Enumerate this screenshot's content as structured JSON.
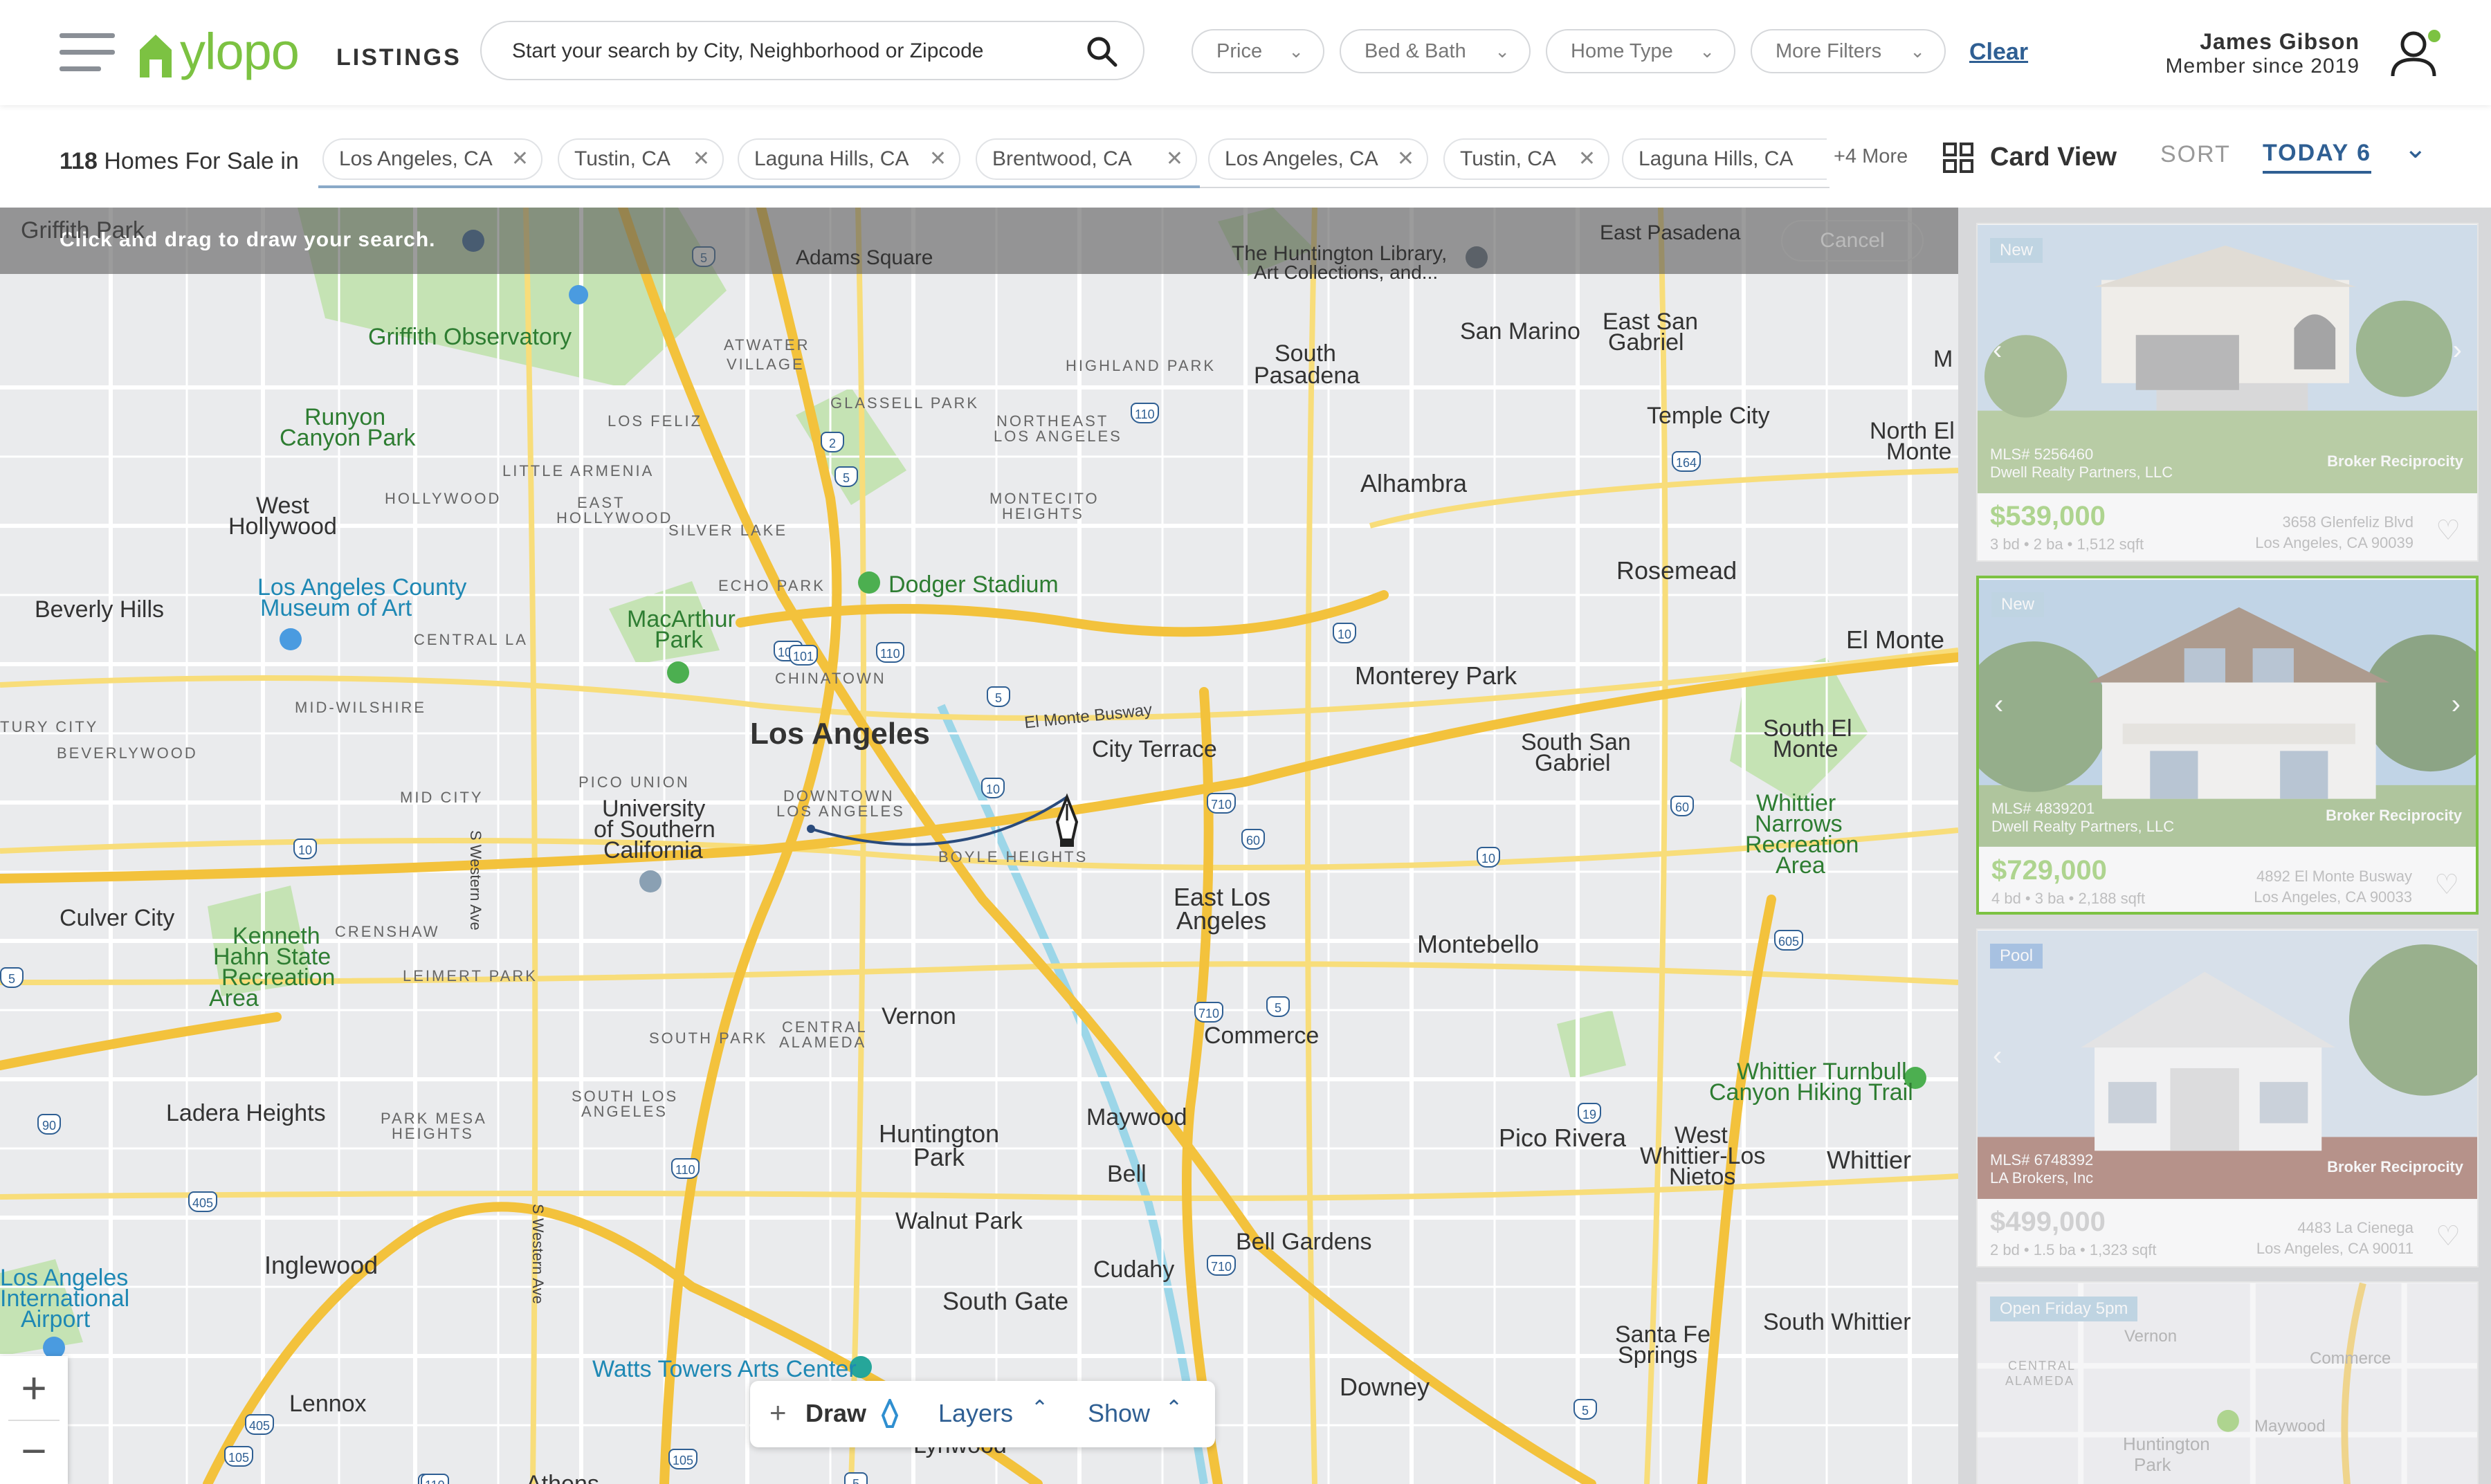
{
  "header": {
    "logo_text": "ylopo",
    "nav_label": "LISTINGS",
    "search": {
      "placeholder": "Start your search by City, Neighborhood or Zipcode"
    },
    "filters": [
      "Price",
      "Bed & Bath",
      "Home Type",
      "More Filters"
    ],
    "clear_label": "Clear",
    "user": {
      "name": "James Gibson",
      "since": "Member since 2019",
      "online_color": "#7cc242"
    }
  },
  "filter_bar": {
    "count": "118",
    "count_suffix": "Homes For Sale in",
    "chips": [
      "Los Angeles, CA",
      "Tustin, CA",
      "Laguna Hills, CA",
      "Brentwood, CA",
      "Los Angeles, CA",
      "Tustin, CA",
      "Laguna Hills, CA"
    ],
    "more_label": "+4 More",
    "view_label": "Card View",
    "sort_label": "SORT",
    "sort_value": "TODAY 6"
  },
  "map": {
    "draw_hint": "Click and drag to draw your search.",
    "cancel_label": "Cancel",
    "labels": {
      "griffith_park": "Griffith Park",
      "adams_square": "Adams Square",
      "huntington_library": "The Huntington Library,",
      "huntington_library2": "Art Collections, and...",
      "east_pasadena": "East Pasadena",
      "griffith_observatory": "Griffith Observatory",
      "atwater": "ATWATER",
      "atwater2": "VILLAGE",
      "highland_park": "HIGHLAND PARK",
      "south_pasadena": "South",
      "south_pasadena2": "Pasadena",
      "san_marino": "San Marino",
      "east_san_gabriel": "East San",
      "east_san_gabriel2": "Gabriel",
      "runyon": "Runyon",
      "runyon2": "Canyon Park",
      "los_feliz": "LOS FELIZ",
      "glassell_park": "GLASSELL PARK",
      "ne_la": "NORTHEAST",
      "ne_la2": "LOS ANGELES",
      "temple_city": "Temple City",
      "north_el_monte": "North El",
      "north_el_monte2": "Monte",
      "little_armenia": "LITTLE ARMENIA",
      "west_hollywood": "West",
      "west_hollywood2": "Hollywood",
      "hollywood": "HOLLYWOOD",
      "east_hollywood": "EAST",
      "east_hollywood2": "HOLLYWOOD",
      "montecito_heights": "MONTECITO",
      "montecito_heights2": "HEIGHTS",
      "alhambra": "Alhambra",
      "silver_lake": "SILVER LAKE",
      "rosemead": "Rosemead",
      "beverly_hills": "Beverly Hills",
      "lacma": "Los Angeles County",
      "lacma2": "Museum of Art",
      "macarthur": "MacArthur",
      "macarthur2": "Park",
      "echo_park": "ECHO PARK",
      "dodger_stadium": "Dodger Stadium",
      "central_la": "CENTRAL LA",
      "el_monte": "El Monte",
      "monterey_park": "Monterey Park",
      "chinatown": "CHINATOWN",
      "mid_wilshire": "MID-WILSHIRE",
      "los_angeles": "Los Angeles",
      "el_monte_busway": "El Monte Busway",
      "city_terrace": "City Terrace",
      "south_san_gabriel": "South San",
      "south_san_gabriel2": "Gabriel",
      "south_el_monte": "South El",
      "south_el_monte2": "Monte",
      "tury_city": "TURY CITY",
      "beverlywood": "BEVERLYWOOD",
      "pico_union": "PICO UNION",
      "downtown": "DOWNTOWN",
      "downtown2": "LOS ANGELES",
      "mid_city": "MID CITY",
      "usc": "University",
      "usc2": "of Southern",
      "usc3": "California",
      "whittier_narrows": "Whittier",
      "whittier_narrows2": "Narrows",
      "whittier_narrows3": "Recreation",
      "whittier_narrows4": "Area",
      "boyle_heights": "BOYLE HEIGHTS",
      "culver_city": "Culver City",
      "crenshaw": "CRENSHAW",
      "east_la": "East Los",
      "east_la2": "Angeles",
      "kenneth_hahn": "Kenneth",
      "kenneth_hahn2": "Hahn State",
      "kenneth_hahn3": "Recreation",
      "kenneth_hahn4": "Area",
      "leimert_park": "LEIMERT PARK",
      "montebello": "Montebello",
      "vernon": "Vernon",
      "commerce": "Commerce",
      "south_park": "SOUTH PARK",
      "central_alameda": "CENTRAL",
      "central_alameda2": "ALAMEDA",
      "whittier_turnbull": "Whittier Turnbull",
      "whittier_turnbull2": "Canyon Hiking Trail",
      "south_la": "SOUTH LOS",
      "south_la2": "ANGELES",
      "ladera_heights": "Ladera Heights",
      "park_mesa": "PARK MESA",
      "park_mesa2": "HEIGHTS",
      "maywood": "Maywood",
      "pico_rivera": "Pico Rivera",
      "west_whittier": "West",
      "west_whittier2": "Whittier-Los",
      "west_whittier3": "Nietos",
      "whittier": "Whittier",
      "huntington_park": "Huntington",
      "huntington_park2": "Park",
      "bell": "Bell",
      "walnut_park": "Walnut Park",
      "inglewood": "Inglewood",
      "bell_gardens": "Bell Gardens",
      "cudahy": "Cudahy",
      "lax": "Los Angeles",
      "lax2": "International",
      "lax3": "Airport",
      "south_gate": "South Gate",
      "south_whittier": "South Whittier",
      "santa_fe_springs": "Santa Fe",
      "santa_fe_springs2": "Springs",
      "watts_towers": "Watts Towers Arts Center",
      "lennox": "Lennox",
      "downey": "Downey",
      "lynwood": "Lynwood",
      "athens": "Athens",
      "w_ave": "S Western Ave",
      "m_edge": "M"
    },
    "shields": [
      "101",
      "5",
      "2",
      "110",
      "5",
      "164",
      "10",
      "101",
      "110",
      "5",
      "10",
      "10",
      "710",
      "60",
      "60",
      "10",
      "605",
      "710",
      "5",
      "90",
      "19",
      "110",
      "405",
      "710",
      "405",
      "5",
      "105",
      "105",
      "105",
      "5",
      "110",
      "5"
    ],
    "tools": {
      "draw": "Draw",
      "layers": "Layers",
      "show": "Show"
    }
  },
  "listings": [
    {
      "badge": "New",
      "mls": "MLS# 5256460",
      "broker": "Dwell Realty Partners, LLC",
      "price": "$539,000",
      "meta": "3 bd • 2 ba • 1,512 sqft",
      "addr1": "3658 Glenfeliz Blvd",
      "addr2": "Los Angeles, CA 90039",
      "badge_color": "#9cc2d9"
    },
    {
      "badge": "New",
      "mls": "MLS# 4839201",
      "broker": "Dwell Realty Partners, LLC",
      "price": "$729,000",
      "meta": "4 bd • 3 ba • 2,188 sqft",
      "addr1": "4892 El Monte Busway",
      "addr2": "Los Angeles, CA 90033",
      "badge_color": "#9cc2d9"
    },
    {
      "badge": "Pool",
      "mls": "MLS# 6748392",
      "broker": "LA Brokers, Inc",
      "price": "$499,000",
      "meta": "2 bd • 1.5 ba • 1,323 sqft",
      "addr1": "4483 La Cienega",
      "addr2": "Los Angeles, CA 90011",
      "badge_color": "#6f9fd8"
    },
    {
      "badge": "Open Friday 5pm",
      "map_labels": [
        "Vernon",
        "Commerce",
        "CENTRAL",
        "ALAMEDA",
        "Maywood",
        "Huntington",
        "Park"
      ],
      "badge_color": "#9cc2d9"
    }
  ],
  "broker_logo": "Broker Reciprocity",
  "colors": {
    "brand": "#7cc242",
    "link": "#2f5f93",
    "highway": "#f6cf3f",
    "water": "#9cd6e8",
    "park": "#c5e3b4"
  }
}
